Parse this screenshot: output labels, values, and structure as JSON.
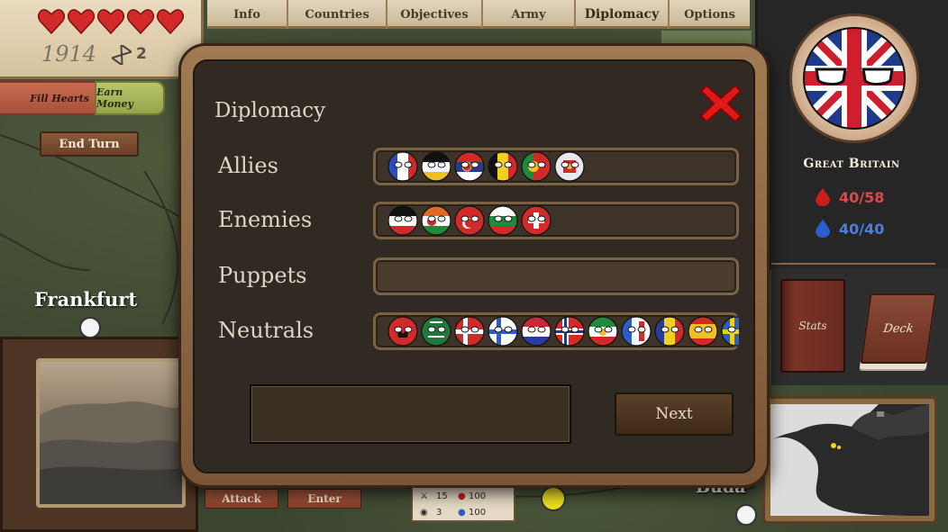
{
  "status": {
    "hearts": 5,
    "year": "1914",
    "turns": "2"
  },
  "actions": {
    "fill_hearts": "Fill Hearts",
    "earn_money": "Earn Money",
    "end_turn": "End Turn"
  },
  "tabs": [
    {
      "label": "Info"
    },
    {
      "label": "Countries"
    },
    {
      "label": "Objectives"
    },
    {
      "label": "Army"
    },
    {
      "label": "Diplomacy",
      "active": true
    },
    {
      "label": "Options"
    }
  ],
  "country": {
    "name": "Great Britain",
    "hp_red": "40/58",
    "hp_blue": "40/40"
  },
  "books": {
    "stats": "Stats",
    "deck": "Deck"
  },
  "map": {
    "city_left": "Frankfurt",
    "city_right": "Buda"
  },
  "card_actions": {
    "attack": "Attack",
    "enter": "Enter"
  },
  "unit": {
    "attack": "15",
    "hp": "100",
    "defense": "3",
    "mana": "100"
  },
  "dialog": {
    "title": "Diplomacy",
    "rows": {
      "allies": {
        "label": "Allies",
        "countries": [
          "france-ball",
          "germany-imperial-ball",
          "serbia-ball",
          "belgium-ball",
          "portugal-ball",
          "montenegro-ball"
        ]
      },
      "enemies": {
        "label": "Enemies",
        "countries": [
          "german-empire-ball",
          "bulgaria-variant-ball",
          "ottoman-ball",
          "bulgaria-ball",
          "switzerland-ball"
        ]
      },
      "puppets": {
        "label": "Puppets",
        "countries": []
      },
      "neutrals": {
        "label": "Neutrals",
        "countries": [
          "albania-ball",
          "saudi-ball",
          "denmark-ball",
          "sweden-cross-ball",
          "netherlands-ball",
          "norway-ball",
          "persia-ball",
          "greece-ball",
          "romania-ball",
          "spain-ball",
          "sweden-ball"
        ]
      }
    },
    "next_label": "Next"
  },
  "colors": {
    "accent_red": "#e04848",
    "accent_blue": "#4a7ee0",
    "dialog_bg": "#302a22",
    "frame_wood": "#8a6a44"
  }
}
